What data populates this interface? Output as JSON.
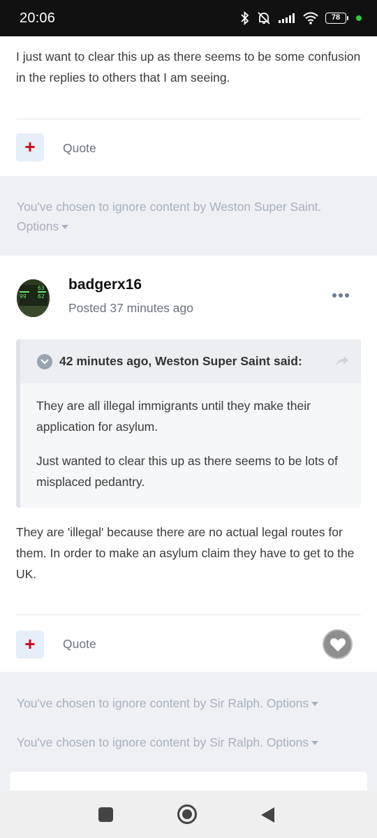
{
  "status_bar": {
    "time": "20:06",
    "battery": "78"
  },
  "post_top": {
    "text": "I just want to clear this up as there seems to be some confusion in the replies to others that I am seeing.",
    "quote_label": "Quote"
  },
  "ignored_1": {
    "text": "You've chosen to ignore content by Weston Super Saint.",
    "options_label": "Options"
  },
  "post_main": {
    "author": "badgerx16",
    "posted": "Posted 37 minutes ago",
    "avatar_digits": {
      "top": "63",
      "left": "99",
      "right": "62"
    },
    "quote": {
      "header": "42 minutes ago, Weston Super Saint said:",
      "paragraphs": [
        "They are all illegal immigrants until they make their application for asylum.",
        "Just wanted to clear this up as there seems to be lots of misplaced pedantry."
      ]
    },
    "text": "They are 'illegal' because there are no actual legal routes for them. In order to make an asylum claim they have to get to the UK.",
    "quote_label": "Quote"
  },
  "ignored_2": {
    "text": "You've chosen to ignore content by Sir Ralph.",
    "options_label": "Options"
  },
  "ignored_3": {
    "text": "You've chosen to ignore content by Sir Ralph.",
    "options_label": "Options"
  },
  "icons": {
    "bluetooth": "bluetooth-icon",
    "mute": "bell-off-icon",
    "signal": "signal-icon",
    "wifi": "wifi-icon",
    "plus": "plus-icon",
    "more": "more-icon",
    "chevron": "chevron-down-icon",
    "share": "share-icon",
    "heart": "heart-icon"
  },
  "colors": {
    "accent_red": "#d0021b",
    "muted_text": "#a7b0bd",
    "background": "#eef0f4"
  }
}
